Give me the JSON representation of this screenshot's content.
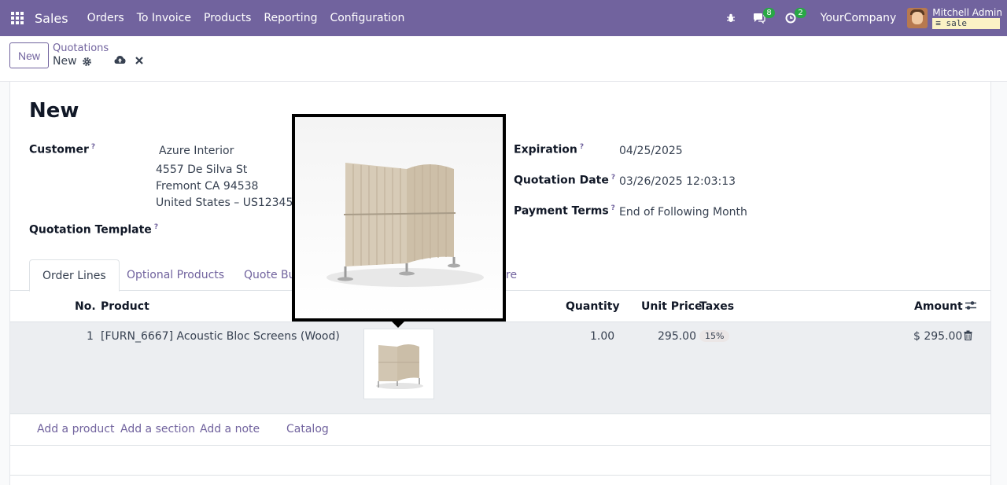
{
  "navbar": {
    "app_name": "Sales",
    "menu": [
      "Orders",
      "To Invoice",
      "Products",
      "Reporting",
      "Configuration"
    ],
    "messages_count": "8",
    "activities_count": "2",
    "company": "YourCompany",
    "user_name": "Mitchell Admin",
    "db_name": "sale"
  },
  "control": {
    "new_button": "New",
    "breadcrumb": "Quotations",
    "record_name": "New"
  },
  "form": {
    "title": "New",
    "customer_label": "Customer",
    "customer_name": "Azure Interior",
    "address_line1": "4557 De Silva St",
    "address_line2": "Fremont CA 94538",
    "address_line3": "United States – US12345677",
    "template_label": "Quotation Template",
    "expiration_label": "Expiration",
    "expiration_value": "04/25/2025",
    "quotation_date_label": "Quotation Date",
    "quotation_date_value": "03/26/2025 12:03:13",
    "payment_terms_label": "Payment Terms",
    "payment_terms_value": "End of Following Month",
    "help_mark": "?"
  },
  "tabs": {
    "order_lines": "Order Lines",
    "optional_products": "Optional Products",
    "quote_builder": "Quote Bu",
    "last_partial": "re"
  },
  "table": {
    "headers": {
      "no": "No.",
      "product": "Product",
      "quantity": "Quantity",
      "unit_price": "Unit Price",
      "taxes": "Taxes",
      "amount": "Amount"
    },
    "rows": [
      {
        "no": "1",
        "product": "[FURN_6667] Acoustic Bloc Screens (Wood)",
        "quantity": "1.00",
        "unit_price": "295.00",
        "tax": "15%",
        "amount": "$ 295.00"
      }
    ]
  },
  "actions": {
    "add_product": "Add a product",
    "add_section": "Add a section",
    "add_note": "Add a note",
    "catalog": "Catalog"
  },
  "icons": {
    "apps": "apps-grid-icon",
    "bug": "bug-icon",
    "chat": "chat-icon",
    "clock": "clock-icon",
    "gear": "gear-icon",
    "save": "cloud-upload-icon",
    "discard": "close-icon",
    "trash": "trash-icon",
    "columns": "column-settings-icon"
  },
  "colors": {
    "brand": "#71639e",
    "badge_green": "#28a745",
    "row_highlight": "#eceef1"
  }
}
